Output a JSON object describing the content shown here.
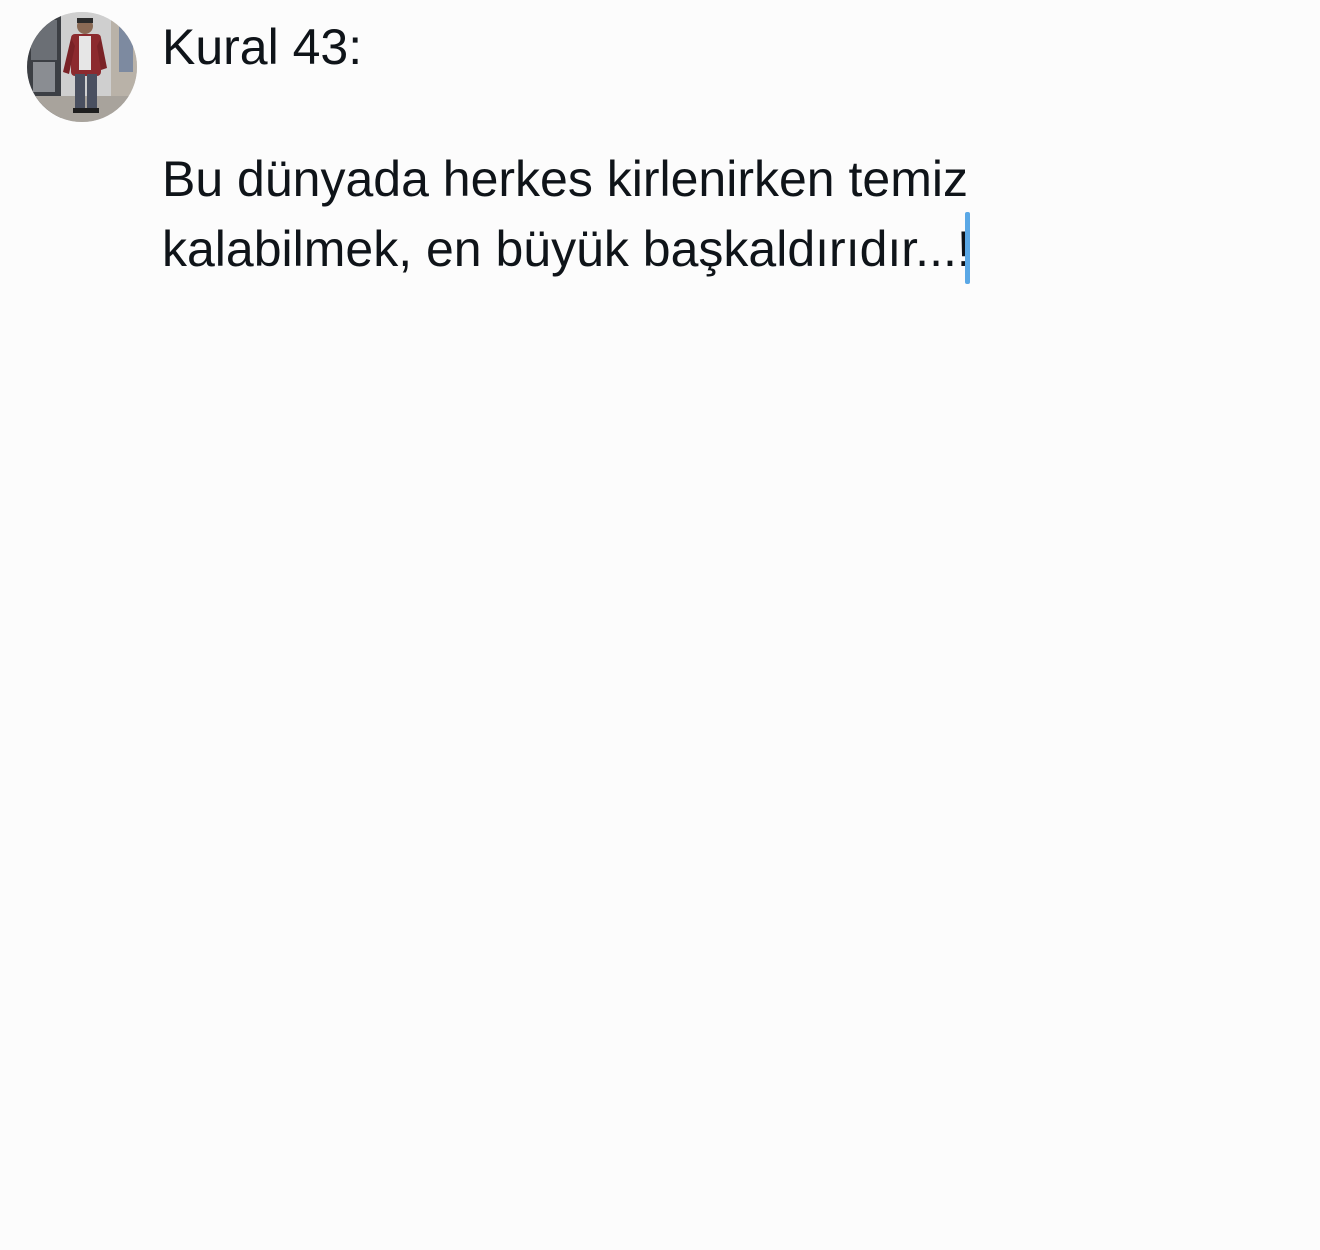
{
  "composer": {
    "avatar_icon": "user-avatar-photo",
    "lines": [
      "Kural 43:",
      "",
      "Bu dünyada herkes kirlenirken temiz",
      "kalabilmek, en büyük başkaldırıdır...!"
    ],
    "caret_color": "#5aa8e6",
    "text_color": "#0f1419",
    "background_color": "#fcfcfc"
  }
}
